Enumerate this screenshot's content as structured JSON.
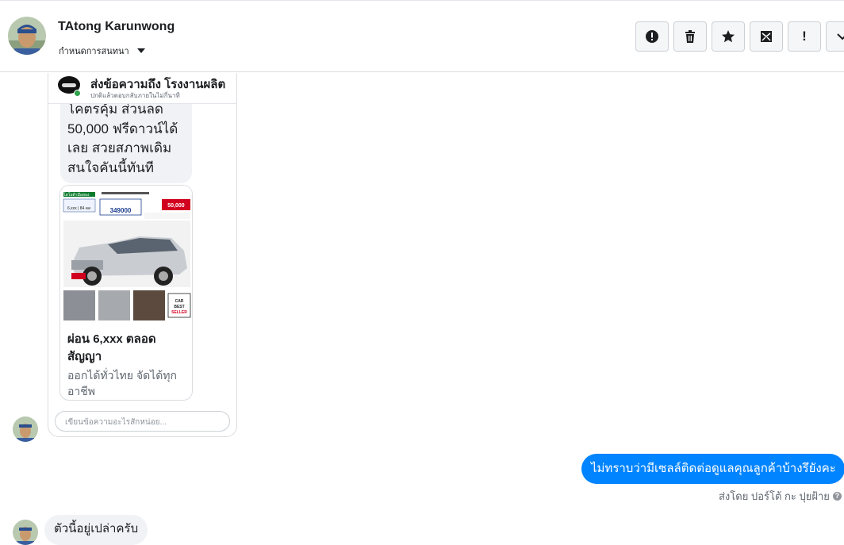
{
  "header": {
    "contact_name": "TAtong Karunwong",
    "conversation_settings": "กำหนดการสนทนา",
    "actions": [
      {
        "name": "report-button",
        "icon": "alert-circle-icon"
      },
      {
        "name": "delete-button",
        "icon": "trash-icon"
      },
      {
        "name": "star-button",
        "icon": "star-icon"
      },
      {
        "name": "mark-unread-button",
        "icon": "envelope-icon"
      },
      {
        "name": "important-button",
        "icon": "exclamation-icon",
        "label": "!"
      },
      {
        "name": "more-button",
        "icon": "chevron-down-icon"
      }
    ]
  },
  "ad_card": {
    "send_to": "ส่งข้อความถึง โรงงานผลิต",
    "reply_time": "ปกติแล้วตอบกลับภายในไม่กี่นาที",
    "message_lines": [
      "โคตรคุ้ม ส่วนลด",
      "50,000 ฟรีดาวน์ได้",
      "เลย สวยสภาพเดิม",
      "สนใจคันนี้ทันที"
    ],
    "image": {
      "top_left_label": "โตโยต้ามือสอง",
      "installment": "6,xxx | 84 ดด",
      "price": "349000",
      "discount": "50,000",
      "badge": "CAR BEST SELLER"
    },
    "title": "ผ่อน 6,xxx ตลอดสัญญา",
    "description": "ออกได้ทั่วไทย จัดได้ทุกอาชีพ",
    "composer_placeholder": "เขียนข้อความอะไรสักหน่อย..."
  },
  "messages": [
    {
      "direction": "outgoing",
      "text": "ไม่ทราบว่ามีเซลล์ติดต่อดูแลคุณลูกค้าบ้างรึยังคะ",
      "sent_by": "ส่งโดย ปอร์โต้ กะ ปุยฝ้าย"
    },
    {
      "direction": "incoming",
      "text": "ตัวนี้อยู่เปล่าครับ"
    }
  ],
  "colors": {
    "accent_blue": "#0084ff",
    "bubble_gray": "#f0f2f5",
    "online_green": "#31a24c"
  }
}
